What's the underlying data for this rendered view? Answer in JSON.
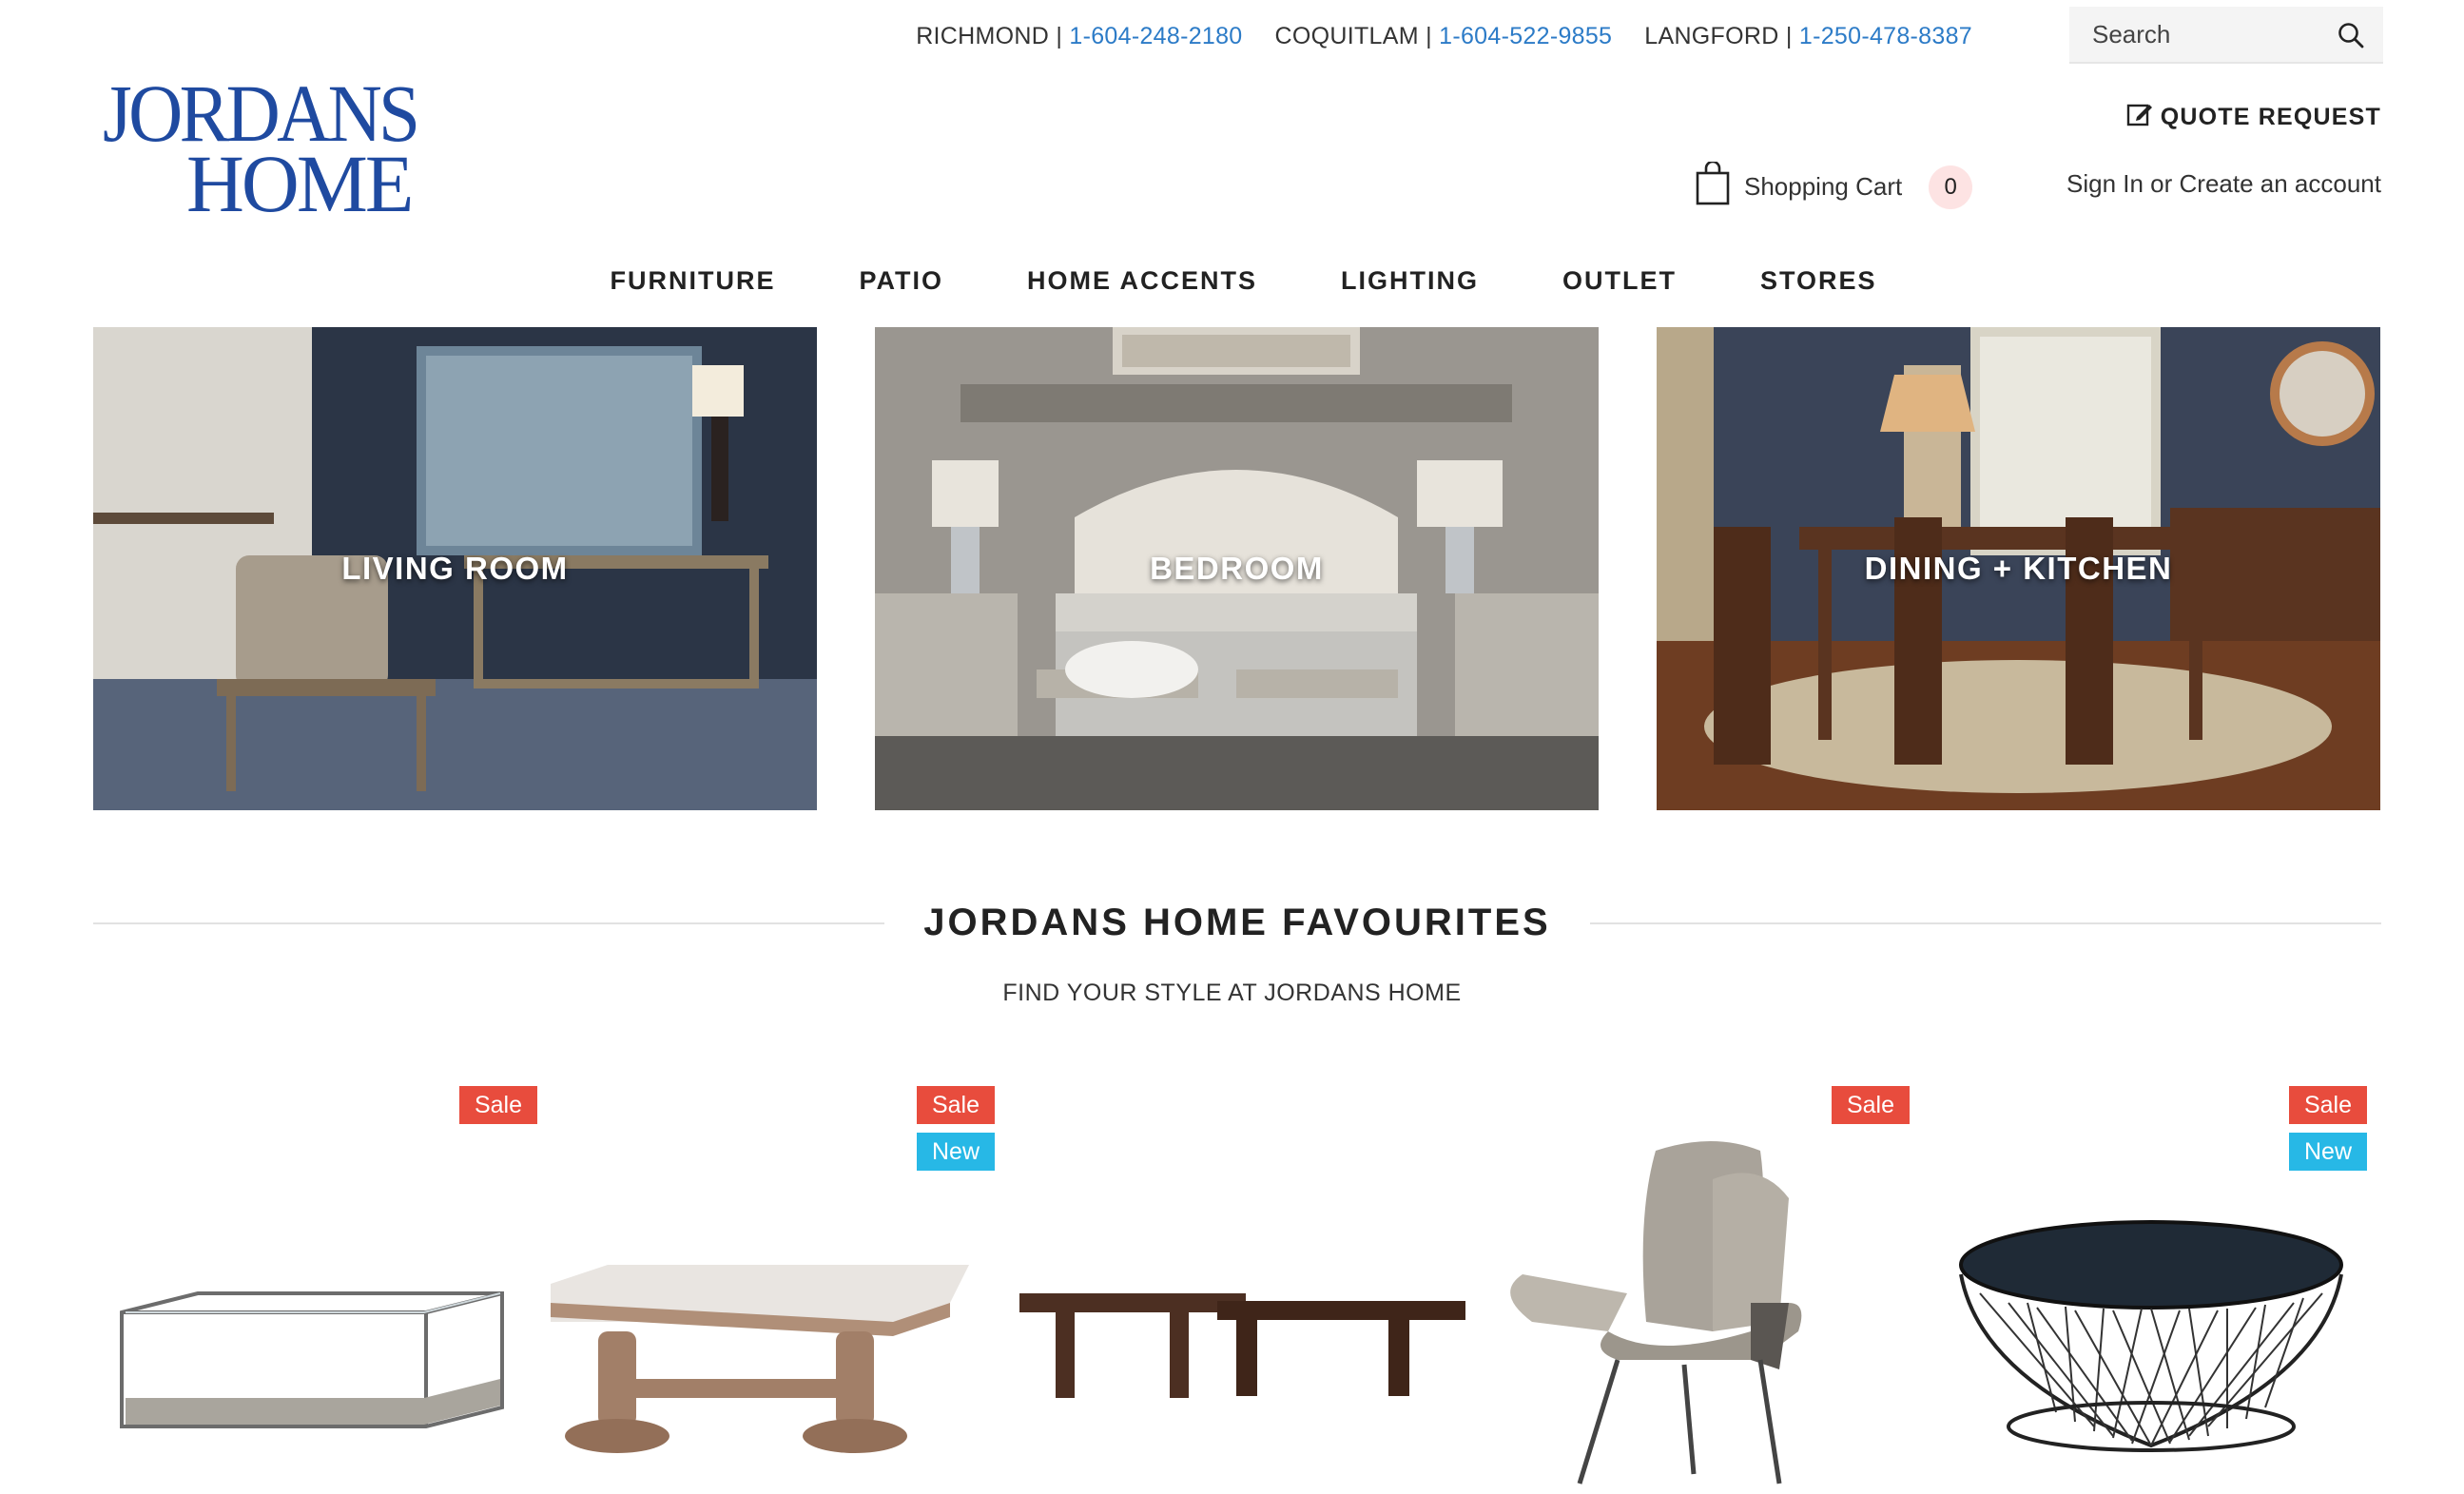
{
  "header": {
    "stores": [
      {
        "name": "RICHMOND",
        "phone": "1-604-248-2180"
      },
      {
        "name": "COQUITLAM",
        "phone": "1-604-522-9855"
      },
      {
        "name": "LANGFORD",
        "phone": "1-250-478-8387"
      }
    ],
    "search_placeholder": "Search",
    "logo_line1": "JORDANS",
    "logo_line2": "HOME",
    "quote_label": "QUOTE REQUEST",
    "cart_label": "Shopping Cart",
    "cart_count": "0",
    "account_label": "Sign In or Create an account"
  },
  "nav": [
    "FURNITURE",
    "PATIO",
    "HOME ACCENTS",
    "LIGHTING",
    "OUTLET",
    "STORES"
  ],
  "categories": [
    {
      "label": "LIVING ROOM"
    },
    {
      "label": "BEDROOM"
    },
    {
      "label": "DINING + KITCHEN"
    }
  ],
  "favourites": {
    "title": "JORDANS HOME FAVOURITES",
    "subtitle": "FIND YOUR STYLE AT JORDANS HOME"
  },
  "products": [
    {
      "badges": [
        "Sale"
      ],
      "icon": "glass-coffee-table"
    },
    {
      "badges": [
        "Sale",
        "New"
      ],
      "icon": "marble-trestle-coffee-table"
    },
    {
      "badges": [],
      "icon": "wood-nesting-coffee-table"
    },
    {
      "badges": [
        "Sale"
      ],
      "icon": "wingback-lounge-chair"
    },
    {
      "badges": [
        "Sale",
        "New"
      ],
      "icon": "wire-drum-coffee-table"
    }
  ],
  "colors": {
    "phone": "#2c7bc7",
    "logo": "#1f4aa0",
    "sale_badge": "#e84c3d",
    "new_badge": "#27b8e6",
    "cart_count_bg": "#fde3e3"
  }
}
